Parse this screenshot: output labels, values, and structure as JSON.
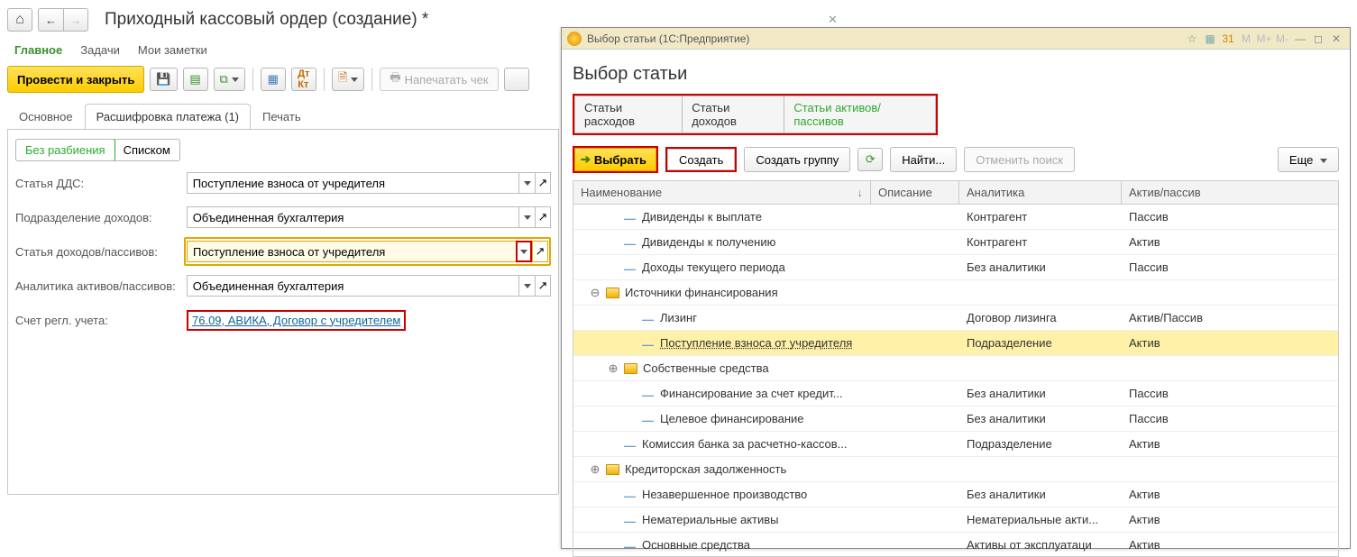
{
  "header": {
    "title": "Приходный кассовый ордер (создание) *"
  },
  "nav": {
    "main": "Главное",
    "tasks": "Задачи",
    "notes": "Мои заметки"
  },
  "toolbar": {
    "post_and_close": "Провести и закрыть",
    "print_check": "Напечатать чек"
  },
  "tabs": {
    "main": "Основное",
    "decoding": "Расшифровка платежа (1)",
    "print": "Печать"
  },
  "segment": {
    "no_split": "Без разбиения",
    "list": "Списком"
  },
  "form": {
    "dds_label": "Статья ДДС:",
    "dds_value": "Поступление взноса от учредителя",
    "division_label": "Подразделение доходов:",
    "division_value": "Объединенная бухгалтерия",
    "income_label": "Статья доходов/пассивов:",
    "income_value": "Поступление взноса от учредителя",
    "analytics_label": "Аналитика активов/пассивов:",
    "analytics_value": "Объединенная бухгалтерия",
    "account_label": "Счет регл. учета:",
    "account_value": "76.09, АВИКА, Договор с учредителем"
  },
  "dialog": {
    "frame_title": "Выбор статьи  (1С:Предприятие)",
    "title": "Выбор статьи",
    "cats": {
      "expenses": "Статьи расходов",
      "income": "Статьи доходов",
      "assets": "Статьи активов/пассивов"
    },
    "buttons": {
      "select": "Выбрать",
      "create": "Создать",
      "create_group": "Создать группу",
      "find": "Найти...",
      "cancel_search": "Отменить поиск",
      "more": "Еще"
    },
    "columns": {
      "name": "Наименование",
      "desc": "Описание",
      "analytics": "Аналитика",
      "ap": "Актив/пассив"
    },
    "rows": [
      {
        "indent": 1,
        "type": "item",
        "name": "Дивиденды к выплате",
        "analytics": "Контрагент",
        "ap": "Пассив"
      },
      {
        "indent": 1,
        "type": "item",
        "name": "Дивиденды к получению",
        "analytics": "Контрагент",
        "ap": "Актив"
      },
      {
        "indent": 1,
        "type": "item",
        "name": "Доходы текущего периода",
        "analytics": "Без аналитики",
        "ap": "Пассив"
      },
      {
        "indent": 0,
        "type": "folder",
        "expander": "⊖",
        "name": "Источники финансирования",
        "analytics": "",
        "ap": ""
      },
      {
        "indent": 2,
        "type": "item",
        "name": "Лизинг",
        "analytics": "Договор лизинга",
        "ap": "Актив/Пассив"
      },
      {
        "indent": 2,
        "type": "item",
        "name": "Поступление взноса от учредителя",
        "analytics": "Подразделение",
        "ap": "Актив",
        "selected": true
      },
      {
        "indent": 1,
        "type": "folder",
        "expander": "⊕",
        "name": "Собственные средства",
        "analytics": "",
        "ap": ""
      },
      {
        "indent": 2,
        "type": "item",
        "name": "Финансирование за счет кредит...",
        "analytics": "Без аналитики",
        "ap": "Пассив"
      },
      {
        "indent": 2,
        "type": "item",
        "name": "Целевое финансирование",
        "analytics": "Без аналитики",
        "ap": "Пассив"
      },
      {
        "indent": 1,
        "type": "item",
        "name": "Комиссия банка за расчетно-кассов...",
        "analytics": "Подразделение",
        "ap": "Актив"
      },
      {
        "indent": 0,
        "type": "folder",
        "expander": "⊕",
        "name": "Кредиторская задолженность",
        "analytics": "",
        "ap": ""
      },
      {
        "indent": 1,
        "type": "item",
        "name": "Незавершенное производство",
        "analytics": "Без аналитики",
        "ap": "Актив"
      },
      {
        "indent": 1,
        "type": "item",
        "name": "Нематериальные активы",
        "analytics": "Нематериальные акти...",
        "ap": "Актив"
      },
      {
        "indent": 1,
        "type": "item",
        "name": "Основные средства",
        "analytics": "Активы от эксплуатаци",
        "ap": "Актив"
      }
    ]
  }
}
